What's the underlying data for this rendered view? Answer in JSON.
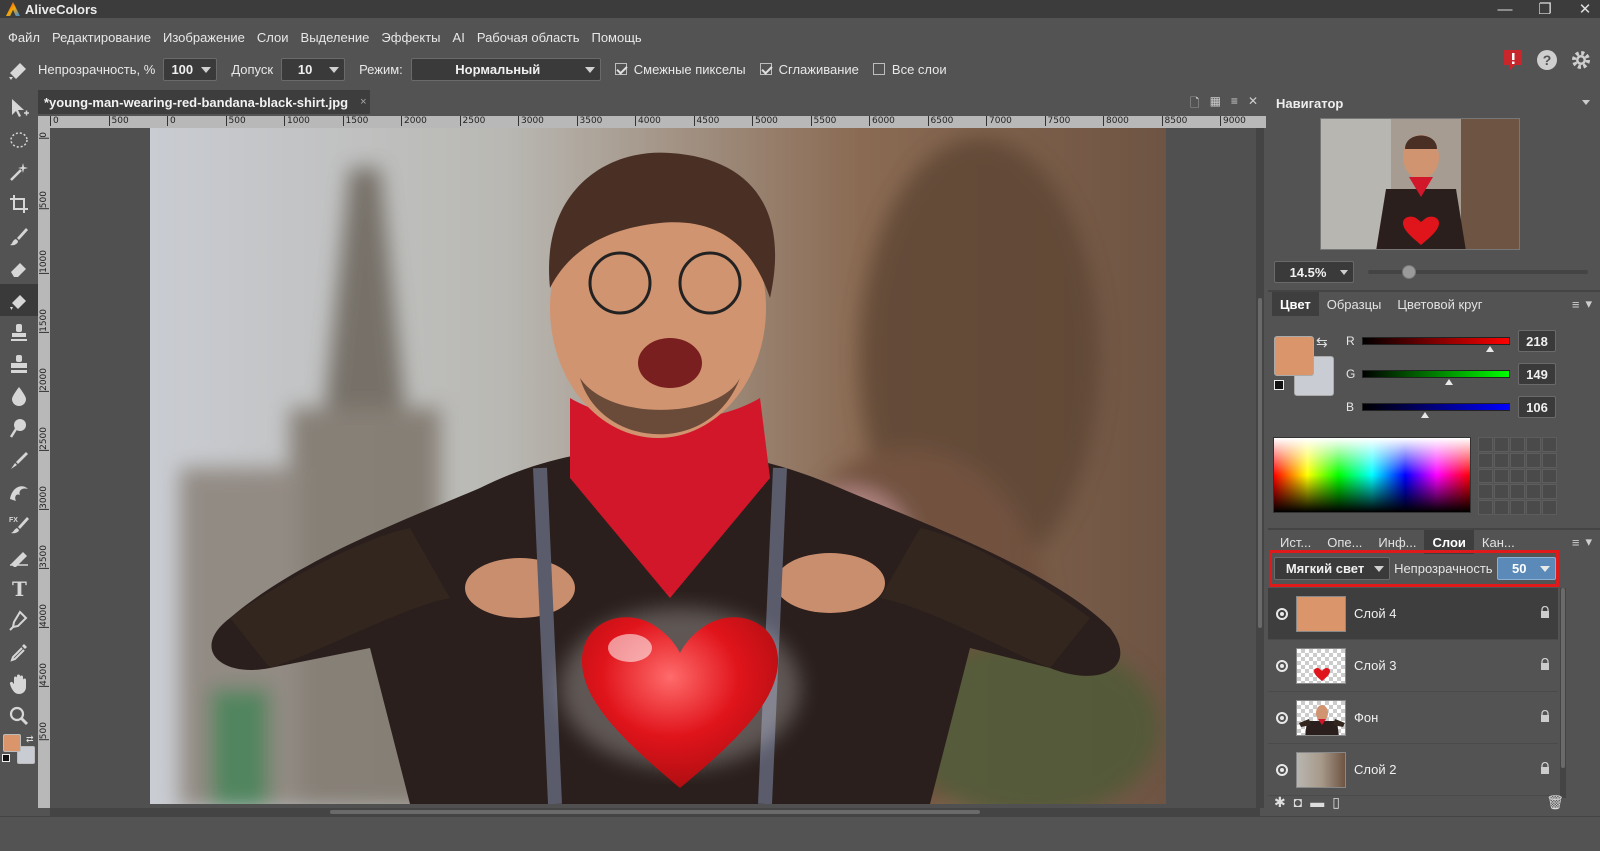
{
  "app": {
    "title": "AliveColors"
  },
  "window_controls": {
    "minimize": "—",
    "restore": "❐",
    "close": "✕"
  },
  "menu": [
    "Файл",
    "Редактирование",
    "Изображение",
    "Слои",
    "Выделение",
    "Эффекты",
    "AI",
    "Рабочая область",
    "Помощь"
  ],
  "options": {
    "opacity_label": "Непрозрачность, %",
    "opacity_value": "100",
    "tolerance_label": "Допуск",
    "tolerance_value": "10",
    "mode_label": "Режим:",
    "mode_value": "Нормальный",
    "contiguous_label": "Смежные пикселы",
    "contiguous_checked": true,
    "antialias_label": "Сглаживание",
    "antialias_checked": true,
    "all_layers_label": "Все слои",
    "all_layers_checked": false
  },
  "document": {
    "tab_title": "*young-man-wearing-red-bandana-black-shirt.jpg",
    "close": "×"
  },
  "ruler": {
    "h_ticks": [
      "0",
      "500",
      "0",
      "500",
      "1000",
      "1500",
      "2000",
      "2500",
      "3000",
      "3500",
      "4000",
      "4500",
      "5000",
      "5500",
      "6000",
      "6500",
      "7000",
      "7500",
      "8000",
      "8500",
      "9000"
    ],
    "v_ticks": [
      "0",
      "500",
      "1000",
      "1500",
      "2000",
      "2500",
      "3000",
      "3500",
      "4000",
      "4500",
      "500"
    ]
  },
  "navigator": {
    "title": "Навигатор",
    "zoom": "14.5%"
  },
  "color_panel": {
    "tabs": [
      "Цвет",
      "Образцы",
      "Цветовой круг"
    ],
    "active_tab": "Цвет",
    "fg_color": "#da956a",
    "bg_color": "#c9cdd3",
    "r_label": "R",
    "r_value": "218",
    "g_label": "G",
    "g_value": "149",
    "b_label": "B",
    "b_value": "106"
  },
  "layers_panel": {
    "tabs": [
      "Ист...",
      "Опе...",
      "Инф...",
      "Слои",
      "Кан..."
    ],
    "active_tab": "Слои",
    "blend_mode": "Мягкий свет",
    "opacity_label": "Непрозрачность",
    "opacity_value": "50",
    "layers": [
      {
        "name": "Слой 4",
        "selected": true
      },
      {
        "name": "Слой 3",
        "selected": false
      },
      {
        "name": "Фон",
        "selected": false
      },
      {
        "name": "Слой 2",
        "selected": false
      }
    ]
  },
  "colors": {
    "highlight_border": "#e01a1a",
    "accent": "#5b8ab8"
  }
}
